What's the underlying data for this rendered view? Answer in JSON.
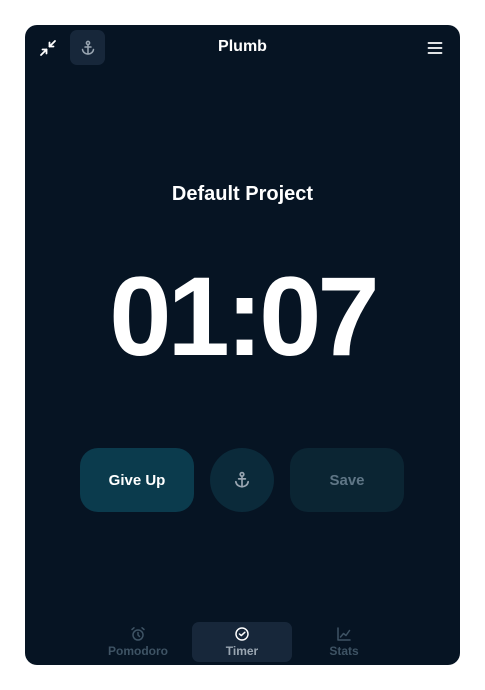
{
  "header": {
    "title": "Plumb",
    "icons": {
      "collapse": "collapse-arrows-icon",
      "anchor": "anchor-icon",
      "menu": "hamburger-menu-icon"
    }
  },
  "main": {
    "project_name": "Default Project",
    "timer": "01:07"
  },
  "controls": {
    "give_up_label": "Give Up",
    "anchor_icon": "anchor-icon",
    "save_label": "Save"
  },
  "nav": {
    "items": [
      {
        "label": "Pomodoro",
        "icon": "alarm-clock-icon",
        "active": false
      },
      {
        "label": "Timer",
        "icon": "clock-icon",
        "active": true
      },
      {
        "label": "Stats",
        "icon": "chart-icon",
        "active": false
      }
    ]
  },
  "colors": {
    "background": "#061423",
    "give_up_bg": "#0b3b4d",
    "save_bg": "#0b2533",
    "active_tab_bg": "#17273a"
  }
}
